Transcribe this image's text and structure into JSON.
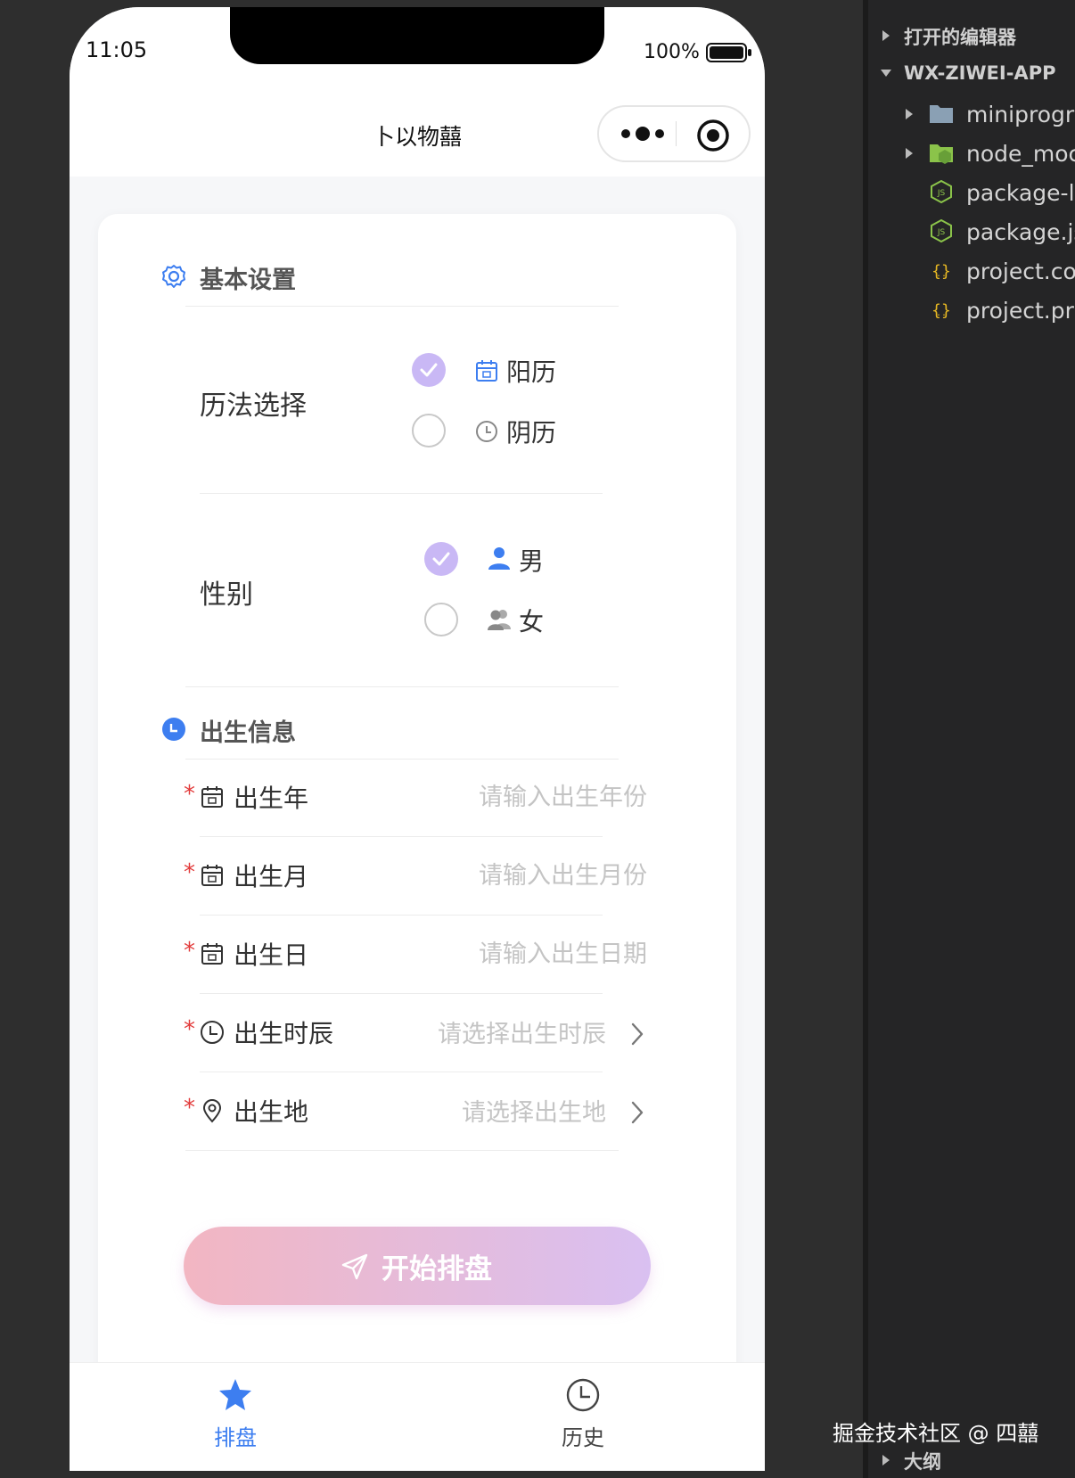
{
  "status": {
    "time": "11:05",
    "battery": "100%"
  },
  "nav": {
    "title": "卜以物囍"
  },
  "basic": {
    "header": "基本设置",
    "calendar": {
      "label": "历法选择",
      "options": [
        {
          "label": "阳历",
          "selected": true,
          "icon": "calendar-icon"
        },
        {
          "label": "阴历",
          "selected": false,
          "icon": "clock-icon"
        }
      ]
    },
    "gender": {
      "label": "性别",
      "options": [
        {
          "label": "男",
          "selected": true,
          "icon": "user-icon"
        },
        {
          "label": "女",
          "selected": false,
          "icon": "user-group-icon"
        }
      ]
    }
  },
  "birth": {
    "header": "出生信息",
    "fields": [
      {
        "label": "出生年",
        "placeholder": "请输入出生年份",
        "icon": "calendar-icon"
      },
      {
        "label": "出生月",
        "placeholder": "请输入出生月份",
        "icon": "calendar-icon"
      },
      {
        "label": "出生日",
        "placeholder": "请输入出生日期",
        "icon": "calendar-icon"
      },
      {
        "label": "出生时辰",
        "placeholder": "请选择出生时辰",
        "icon": "clock-icon"
      },
      {
        "label": "出生地",
        "placeholder": "请选择出生地",
        "icon": "location-icon"
      }
    ],
    "required_mark": "*"
  },
  "start_button": "开始排盘",
  "tabbar": {
    "items": [
      {
        "label": "排盘",
        "active": true,
        "icon": "star-icon"
      },
      {
        "label": "历史",
        "active": false,
        "icon": "clock-icon"
      }
    ]
  },
  "colors": {
    "accent": "#3d7ef0",
    "radio_on": "#c9b8f5",
    "required": "#e23b3b",
    "button_from": "#f2b6c2",
    "button_to": "#d9c0f1"
  },
  "ide": {
    "open_editors": "打开的编辑器",
    "project": "WX-ZIWEI-APP",
    "files": [
      {
        "name": "miniprogra",
        "type": "folder"
      },
      {
        "name": "node_moc",
        "type": "folder-node"
      },
      {
        "name": "package-l",
        "type": "nodejs"
      },
      {
        "name": "package.js",
        "type": "nodejs"
      },
      {
        "name": "project.co",
        "type": "json"
      },
      {
        "name": "project.pri",
        "type": "json"
      }
    ],
    "outline": "大纲"
  },
  "watermark": "掘金技术社区 @ 四囍"
}
